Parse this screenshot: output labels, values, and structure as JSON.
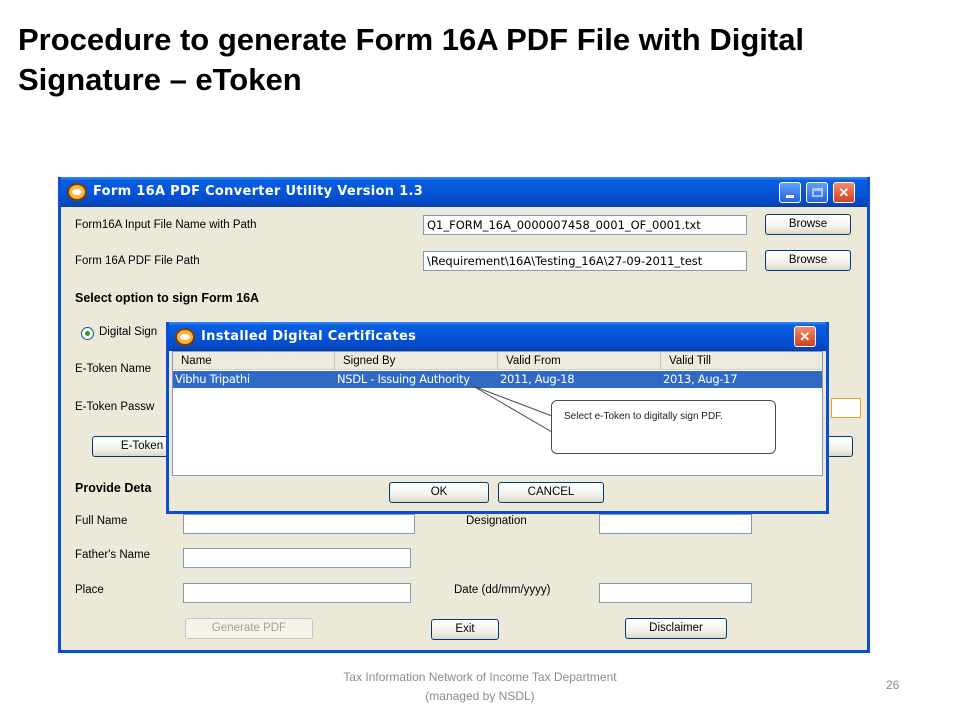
{
  "slide": {
    "title": "Procedure to generate Form 16A PDF File with Digital Signature – eToken",
    "footer": "Tax Information Network of Income Tax Department (managed by NSDL)",
    "page_number": "26"
  },
  "main_window": {
    "title": "Form 16A PDF Converter Utility Version 1.3",
    "input_file_label": "Form16A Input File Name with Path",
    "input_file_value": "Q1_FORM_16A_0000007458_0001_OF_0001.txt",
    "pdf_path_label": "Form 16A PDF File Path",
    "pdf_path_value": "\\Requirement\\16A\\Testing_16A\\27-09-2011_test",
    "browse_label": "Browse",
    "sign_section_label": "Select option to sign Form 16A",
    "digital_sign_option": "Digital Sign",
    "etoken_name_label": "E-Token Name",
    "etoken_password_label": "E-Token Passw",
    "etoken_button": "E-Token",
    "provide_details_label": "Provide Deta",
    "full_name_label": "Full Name",
    "designation_label": "Designation",
    "fathers_name_label": "Father's Name",
    "place_label": "Place",
    "date_label": "Date (dd/mm/yyyy)",
    "generate_pdf_button": "Generate PDF",
    "exit_button": "Exit",
    "disclaimer_button": "Disclaimer"
  },
  "cert_dialog": {
    "title": "Installed Digital Certificates",
    "columns": [
      "Name",
      "Signed By",
      "Valid From",
      "Valid Till"
    ],
    "rows": [
      [
        "Vibhu Tripathi",
        "NSDL - Issuing Authority",
        "2011, Aug-18",
        "2013, Aug-17"
      ]
    ],
    "ok_button": "OK",
    "cancel_button": "CANCEL"
  },
  "callout": {
    "text": "Select  e-Token to digitally sign PDF."
  },
  "colors": {
    "titlebar_blue": "#0556d8",
    "selection_blue": "#316ac5",
    "window_face": "#ece9d8"
  }
}
